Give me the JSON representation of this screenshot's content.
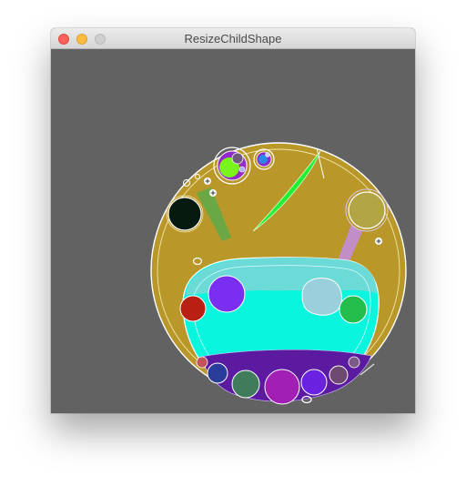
{
  "window": {
    "title": "ResizeChildShape"
  },
  "colors": {
    "canvas_bg": "#626262",
    "outer_disc": "#b99729",
    "basin": "#0af5dd",
    "basin_rim": "#6cdad6",
    "purple_band": "#5c1aa0",
    "green_wedge": "#1ef032",
    "olive_wedge": "#6aa845",
    "lilac_wedge": "#c28ec8"
  },
  "icons": {
    "close": "close-icon",
    "minimize": "minimize-icon",
    "zoom": "zoom-icon",
    "resize_handle": "plus-circle-icon"
  }
}
